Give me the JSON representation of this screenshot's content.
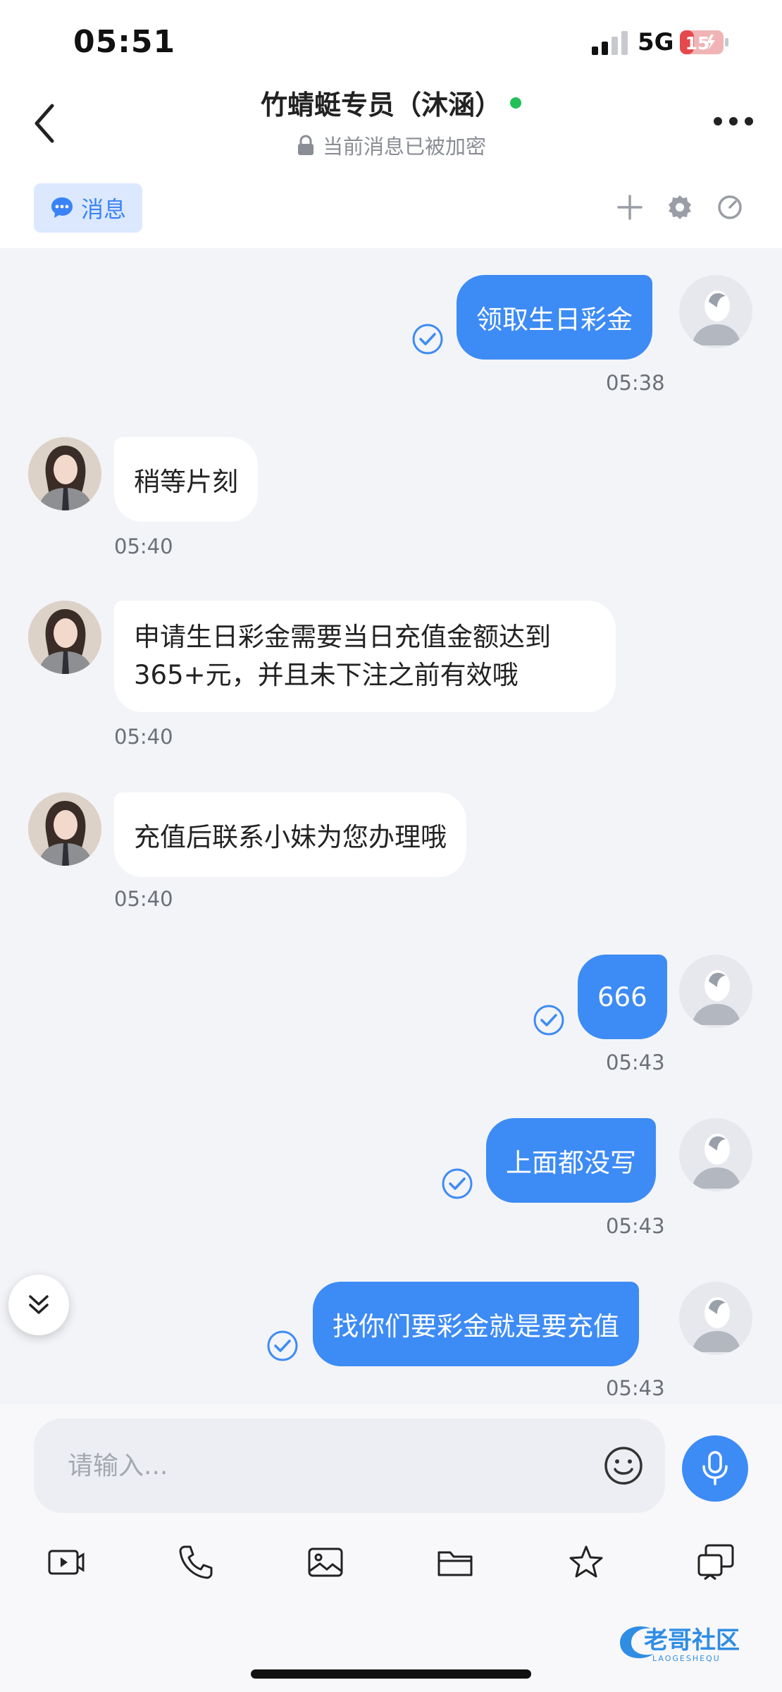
{
  "status_bar": {
    "time": "05:51",
    "network": "5G",
    "battery": "15"
  },
  "header": {
    "title": "竹蜻蜓专员（沐涵）",
    "subtitle": "当前消息已被加密"
  },
  "tabs": {
    "messages_label": "消息"
  },
  "messages": [
    {
      "dir": "out",
      "text": "领取生日彩金",
      "time": "05:38"
    },
    {
      "dir": "in",
      "text": "稍等片刻",
      "time": "05:40"
    },
    {
      "dir": "in",
      "text": "申请生日彩金需要当日充值金额达到365+元，并且未下注之前有效哦",
      "time": "05:40"
    },
    {
      "dir": "in",
      "text": "充值后联系小妹为您办理哦",
      "time": "05:40"
    },
    {
      "dir": "out",
      "text": "666",
      "time": "05:43"
    },
    {
      "dir": "out",
      "text": "上面都没写",
      "time": "05:43"
    },
    {
      "dir": "out",
      "text": "找你们要彩金就是要充值",
      "time": "05:43"
    }
  ],
  "input": {
    "placeholder": "请输入..."
  },
  "colors": {
    "accent": "#3d8bf5",
    "online": "#22c05a",
    "battery_low": "#e5484d"
  },
  "icons": [
    "back-icon",
    "more-icon",
    "chat-bubble-icon",
    "plus-icon",
    "gear-icon",
    "gauge-icon",
    "read-check-icon",
    "double-chevron-down-icon",
    "emoji-icon",
    "microphone-icon",
    "video-icon",
    "phone-icon",
    "image-icon",
    "folder-icon",
    "star-icon",
    "screen-share-icon"
  ],
  "watermark": {
    "text": "老哥社区",
    "sub": "LAOGESHEQU"
  }
}
